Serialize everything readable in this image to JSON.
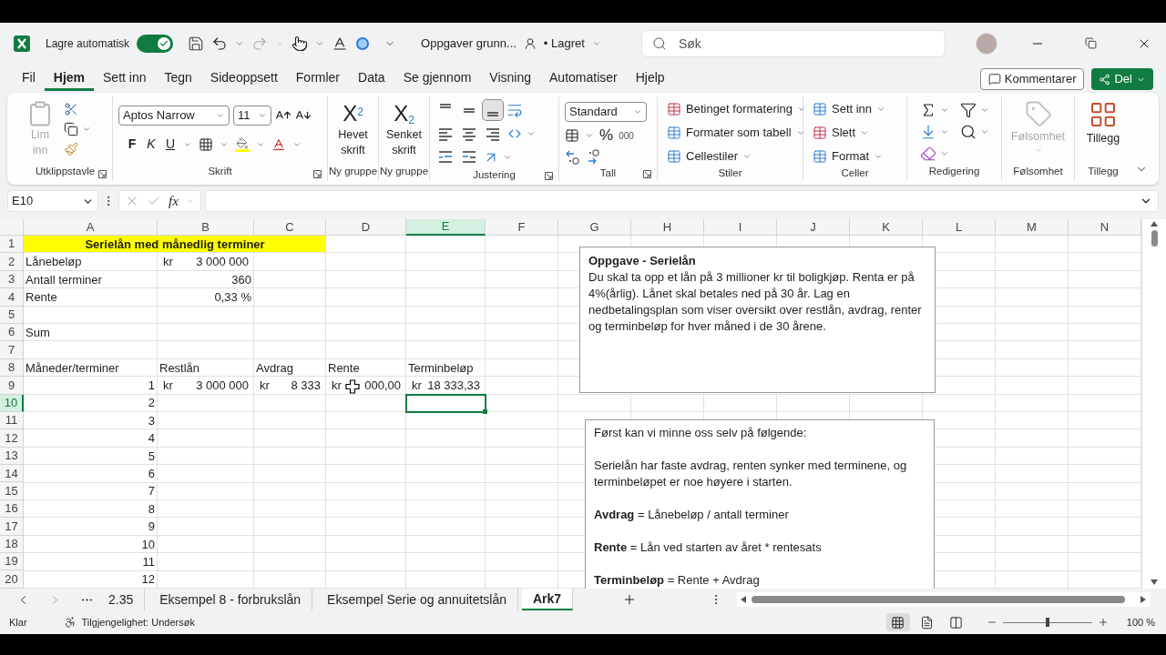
{
  "title_bar": {
    "autosave_label": "Lagre automatisk",
    "autosave_on": true,
    "document_title": "Oppgaver grunn...",
    "save_status": "• Lagret",
    "search_placeholder": "Søk"
  },
  "menu_tabs": [
    {
      "label": "Fil",
      "selected": false
    },
    {
      "label": "Hjem",
      "selected": true
    },
    {
      "label": "Sett inn",
      "selected": false
    },
    {
      "label": "Tegn",
      "selected": false
    },
    {
      "label": "Sideoppsett",
      "selected": false
    },
    {
      "label": "Formler",
      "selected": false
    },
    {
      "label": "Data",
      "selected": false
    },
    {
      "label": "Se gjennom",
      "selected": false
    },
    {
      "label": "Visning",
      "selected": false
    },
    {
      "label": "Automatiser",
      "selected": false
    },
    {
      "label": "Hjelp",
      "selected": false
    }
  ],
  "comment_button": "Kommentarer",
  "share_button": "Del",
  "ribbon_groups": [
    {
      "kind": "clipboard",
      "label": "Utklippstavle",
      "paste": "Lim inn",
      "paste_disabled": true
    },
    {
      "kind": "font",
      "label": "Skrift",
      "font": "Aptos Narrow",
      "size": "11",
      "bold": "F",
      "italic": "K",
      "underline": "U"
    },
    {
      "kind": "script",
      "label": "Ny gruppe",
      "glyph": "X$^{2}$",
      "button": "Hevet skrift"
    },
    {
      "kind": "script",
      "label": "Ny gruppe",
      "glyph": "X$_{2}$",
      "button": "Senket skrift"
    },
    {
      "kind": "alignment",
      "label": "Justering",
      "vertical_align": [
        {
          "selected": false
        },
        {
          "selected": false
        },
        {
          "selected": true
        }
      ]
    },
    {
      "kind": "number",
      "label": "Tall",
      "format": "Standard",
      "percent": "%",
      "thousands": "000"
    },
    {
      "kind": "styles",
      "label": "Stiler",
      "buttons": [
        "Betinget formatering",
        "Formater som tabell",
        "Cellestiler"
      ]
    },
    {
      "kind": "cells",
      "label": "Celler",
      "buttons": [
        "Sett inn",
        "Slett",
        "Format"
      ]
    },
    {
      "kind": "editing",
      "label": "Redigering"
    },
    {
      "kind": "sensitivity",
      "label": "Følsomhet",
      "button": "Følsomhet",
      "disabled": true
    },
    {
      "kind": "addins",
      "label": "Tillegg",
      "button": "Tillegg"
    }
  ],
  "formula_bar": {
    "name_box": "E10",
    "fx": "fx"
  },
  "sheet": {
    "columns": [
      {
        "label": "A",
        "selected": false
      },
      {
        "label": "B",
        "selected": false
      },
      {
        "label": "C",
        "selected": false
      },
      {
        "label": "D",
        "selected": false
      },
      {
        "label": "E",
        "selected": true
      },
      {
        "label": "F",
        "selected": false
      },
      {
        "label": "G",
        "selected": false
      },
      {
        "label": "H",
        "selected": false
      },
      {
        "label": "I",
        "selected": false
      },
      {
        "label": "J",
        "selected": false
      },
      {
        "label": "K",
        "selected": false
      },
      {
        "label": "L",
        "selected": false
      },
      {
        "label": "M",
        "selected": false
      },
      {
        "label": "N",
        "selected": false
      }
    ],
    "rows": [
      {
        "label": "1",
        "selected": false,
        "cells": {
          "A": {
            "kind": "title",
            "text": "Serielån med månedlig terminer"
          }
        }
      },
      {
        "label": "2",
        "selected": false,
        "cells": {
          "A": {
            "kind": "text",
            "text": "Lånebeløp"
          },
          "B": {
            "kind": "currency",
            "currency": "kr",
            "text": "3 000 000"
          }
        }
      },
      {
        "label": "3",
        "selected": false,
        "cells": {
          "A": {
            "kind": "text",
            "text": "Antall terminer"
          },
          "B": {
            "kind": "number",
            "text": "360"
          }
        }
      },
      {
        "label": "4",
        "selected": false,
        "cells": {
          "A": {
            "kind": "text",
            "text": "Rente"
          },
          "B": {
            "kind": "number",
            "text": "0,33 %"
          }
        }
      },
      {
        "label": "5",
        "selected": false,
        "cells": {}
      },
      {
        "label": "6",
        "selected": false,
        "cells": {
          "A": {
            "kind": "text",
            "text": "Sum"
          }
        }
      },
      {
        "label": "7",
        "selected": false,
        "cells": {}
      },
      {
        "label": "8",
        "selected": false,
        "cells": {
          "A": {
            "kind": "text",
            "text": "Måneder/terminer"
          },
          "B": {
            "kind": "text",
            "text": "Restlån"
          },
          "C": {
            "kind": "text",
            "text": "Avdrag"
          },
          "D": {
            "kind": "text",
            "text": "Rente"
          },
          "E": {
            "kind": "text",
            "text": "Terminbeløp"
          }
        }
      },
      {
        "label": "9",
        "selected": false,
        "cells": {
          "A": {
            "kind": "number",
            "text": "1"
          },
          "B": {
            "kind": "currency",
            "currency": "kr",
            "text": "3 000 000"
          },
          "C": {
            "kind": "currency",
            "currency": "kr",
            "text": "8 333"
          },
          "D": {
            "kind": "currency",
            "currency": "kr",
            "text": "000,00"
          },
          "E": {
            "kind": "currency",
            "currency": "kr",
            "text": "18 333,33"
          }
        }
      },
      {
        "label": "10",
        "selected": true,
        "cells": {
          "A": {
            "kind": "number",
            "text": "2"
          }
        }
      },
      {
        "label": "11",
        "selected": false,
        "cells": {
          "A": {
            "kind": "number",
            "text": "3"
          }
        }
      },
      {
        "label": "12",
        "selected": false,
        "cells": {
          "A": {
            "kind": "number",
            "text": "4"
          }
        }
      },
      {
        "label": "13",
        "selected": false,
        "cells": {
          "A": {
            "kind": "number",
            "text": "5"
          }
        }
      },
      {
        "label": "14",
        "selected": false,
        "cells": {
          "A": {
            "kind": "number",
            "text": "6"
          }
        }
      },
      {
        "label": "15",
        "selected": false,
        "cells": {
          "A": {
            "kind": "number",
            "text": "7"
          }
        }
      },
      {
        "label": "16",
        "selected": false,
        "cells": {
          "A": {
            "kind": "number",
            "text": "8"
          }
        }
      },
      {
        "label": "17",
        "selected": false,
        "cells": {
          "A": {
            "kind": "number",
            "text": "9"
          }
        }
      },
      {
        "label": "18",
        "selected": false,
        "cells": {
          "A": {
            "kind": "number",
            "text": "10"
          }
        }
      },
      {
        "label": "19",
        "selected": false,
        "cells": {
          "A": {
            "kind": "number",
            "text": "11"
          }
        }
      },
      {
        "label": "20",
        "selected": false,
        "cells": {
          "A": {
            "kind": "number",
            "text": "12"
          }
        }
      }
    ]
  },
  "text_boxes": [
    {
      "title": "Oppgave - Serielån",
      "paragraphs": [
        "Du skal ta opp et lån på 3 millioner kr til boligkjøp. Renta er på 4%(årlig). Lånet skal betales ned på 30 år. Lag en nedbetalingsplan som viser oversikt over restlån, avdrag, renter og terminbeløp for hver måned i de 30 årene."
      ]
    },
    {
      "paragraphs": [
        "Først kan vi minne oss selv på følgende:",
        "Serielån har faste avdrag, renten synker med terminene, og terminbeløpet er noe høyere i starten.",
        "**Avdrag** = Lånebeløp / antall terminer",
        "**Rente** = Lån ved starten av året * rentesats",
        "**Terminbeløp** = Rente + Avdrag"
      ]
    }
  ],
  "sheet_tabs": [
    {
      "label": "2.35",
      "selected": false
    },
    {
      "label": "Eksempel 8 - forbrukslån",
      "selected": false
    },
    {
      "label": "Eksempel Serie og annuitetslån",
      "selected": false
    },
    {
      "label": "Ark7",
      "selected": true
    }
  ],
  "status_bar": {
    "status": "Klar",
    "accessibility": "Tilgjengelighet: Undersøk",
    "views": [
      {
        "selected": true
      },
      {
        "selected": false
      },
      {
        "selected": false
      }
    ],
    "zoom": {
      "level": 0.5,
      "label": "100 %"
    }
  }
}
